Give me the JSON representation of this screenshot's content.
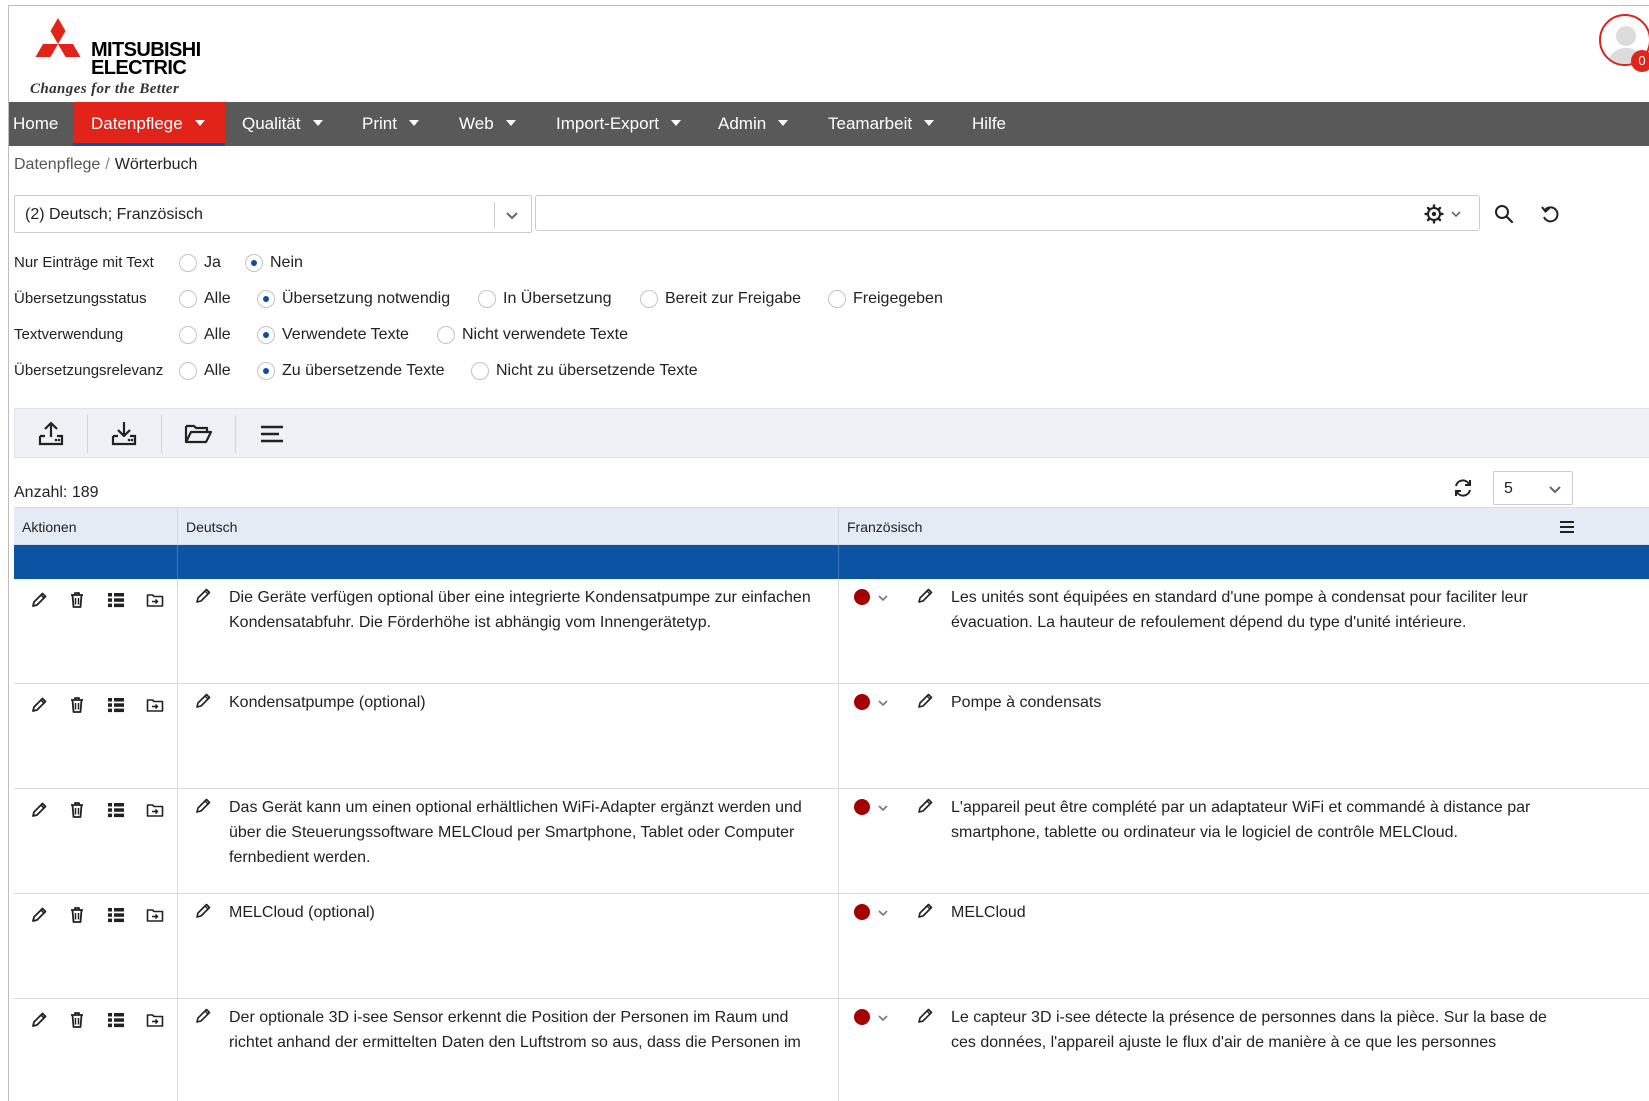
{
  "header": {
    "brand_line1": "MITSUBISHI",
    "brand_line2": "ELECTRIC",
    "tagline": "Changes for the Better",
    "notification_count": "0",
    "brand_color": "#e2231a"
  },
  "nav": {
    "items": [
      {
        "label": "Home",
        "has_menu": false,
        "active": false
      },
      {
        "label": "Datenpflege",
        "has_menu": true,
        "active": true
      },
      {
        "label": "Qualität",
        "has_menu": true,
        "active": false
      },
      {
        "label": "Print",
        "has_menu": true,
        "active": false
      },
      {
        "label": "Web",
        "has_menu": true,
        "active": false
      },
      {
        "label": "Import-Export",
        "has_menu": true,
        "active": false
      },
      {
        "label": "Admin",
        "has_menu": true,
        "active": false
      },
      {
        "label": "Teamarbeit",
        "has_menu": true,
        "active": false
      },
      {
        "label": "Hilfe",
        "has_menu": false,
        "active": false
      }
    ],
    "background": "#595959",
    "active_color": "#e2231a"
  },
  "breadcrumb": {
    "parent": "Datenpflege",
    "separator": "/",
    "current": "Wörterbuch"
  },
  "search": {
    "language_select": "(2) Deutsch; Französisch",
    "query": "",
    "placeholder": ""
  },
  "filters": [
    {
      "label": "Nur Einträge mit Text",
      "options": [
        {
          "label": "Ja",
          "selected": false
        },
        {
          "label": "Nein",
          "selected": true
        }
      ]
    },
    {
      "label": "Übersetzungsstatus",
      "options": [
        {
          "label": "Alle",
          "selected": false
        },
        {
          "label": "Übersetzung notwendig",
          "selected": true
        },
        {
          "label": "In Übersetzung",
          "selected": false
        },
        {
          "label": "Bereit zur Freigabe",
          "selected": false
        },
        {
          "label": "Freigegeben",
          "selected": false
        }
      ]
    },
    {
      "label": "Textverwendung",
      "options": [
        {
          "label": "Alle",
          "selected": false
        },
        {
          "label": "Verwendete Texte",
          "selected": true
        },
        {
          "label": "Nicht verwendete Texte",
          "selected": false
        }
      ]
    },
    {
      "label": "Übersetzungsrelevanz",
      "options": [
        {
          "label": "Alle",
          "selected": false
        },
        {
          "label": "Zu übersetzende Texte",
          "selected": true
        },
        {
          "label": "Nicht zu übersetzende Texte",
          "selected": false
        }
      ]
    }
  ],
  "toolbar": {
    "icons": [
      "upload-icon",
      "download-icon",
      "folder-open-icon",
      "menu-lines-icon"
    ]
  },
  "list": {
    "count_label": "Anzahl: 189",
    "page_size": "5",
    "columns": [
      "Aktionen",
      "Deutsch",
      "Französisch"
    ],
    "filter_row_color": "#0c53a3",
    "status_color": "#a50000",
    "rows": [
      {
        "de": "Die Geräte verfügen optional über eine integrierte Kondensatpumpe zur einfachen Kondensatabfuhr. Die Förderhöhe ist abhängig vom Innengerätetyp.",
        "fr": "Les unités sont équipées en standard d'une pompe à condensat pour faciliter leur évacuation. La hauteur de refoulement dépend du type d'unité intérieure."
      },
      {
        "de": "Kondensatpumpe (optional)",
        "fr": "Pompe à condensats"
      },
      {
        "de": "Das Gerät kann um einen optional erhältlichen WiFi-Adapter ergänzt werden und über die Steuerungssoftware MELCloud per Smartphone, Tablet oder Computer fernbedient werden.",
        "fr": "L'appareil peut être complété par un adaptateur WiFi et commandé à distance par smartphone, tablette ou ordinateur via le logiciel de contrôle MELCloud."
      },
      {
        "de": "MELCloud (optional)",
        "fr": "MELCloud"
      },
      {
        "de": "Der optionale 3D i-see Sensor erkennt die Position der Personen im Raum und richtet anhand der ermittelten Daten den Luftstrom so aus, dass die Personen im",
        "fr": "Le capteur 3D i-see détecte la présence de personnes dans la pièce. Sur la base de ces données, l'appareil ajuste le flux d'air de manière à ce que les personnes"
      }
    ]
  }
}
